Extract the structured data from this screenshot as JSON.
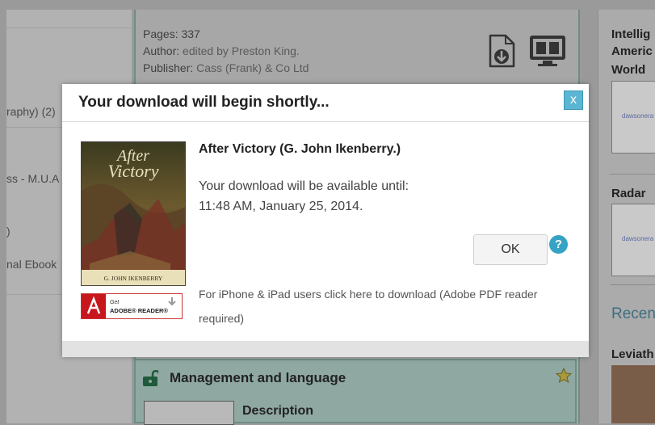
{
  "background": {
    "book_meta": {
      "pages_label": "Pages:",
      "pages_value": "337",
      "author_label": "Author:",
      "author_value": "edited by Preston King.",
      "publisher_label": "Publisher:",
      "publisher_value": "Cass (Frank) & Co Ltd"
    },
    "left_items": [
      "raphy) (2)",
      "ss - M.U.A",
      ")",
      "nal Ebook"
    ],
    "right_titles": [
      "Intellig",
      "Americ",
      "World",
      "Radar"
    ],
    "thumb_label": "dawsonera",
    "recent_label": "Recen",
    "bottom_right_title": "Leviath",
    "next_item": {
      "title": "Management and language",
      "description_label": "Description"
    }
  },
  "modal": {
    "title": "Your download will begin shortly...",
    "close_label": "x",
    "book_title": "After Victory (G. John Ikenberry.)",
    "availability_line1": "Your download will be available until:",
    "availability_line2": "11:48 AM, January 25, 2014.",
    "ok_label": "OK",
    "help_label": "?",
    "iphone_text": "For iPhone & iPad users click here to download (Adobe PDF reader required)",
    "cover": {
      "title_line1": "After",
      "title_line2": "Victory",
      "author": "G. JOHN IKENBERRY"
    },
    "adobe_badge": {
      "line1": "Get",
      "line2": "ADOBE® READER®"
    }
  },
  "colors": {
    "accent": "#5bb6d3",
    "help": "#36a3c4"
  }
}
